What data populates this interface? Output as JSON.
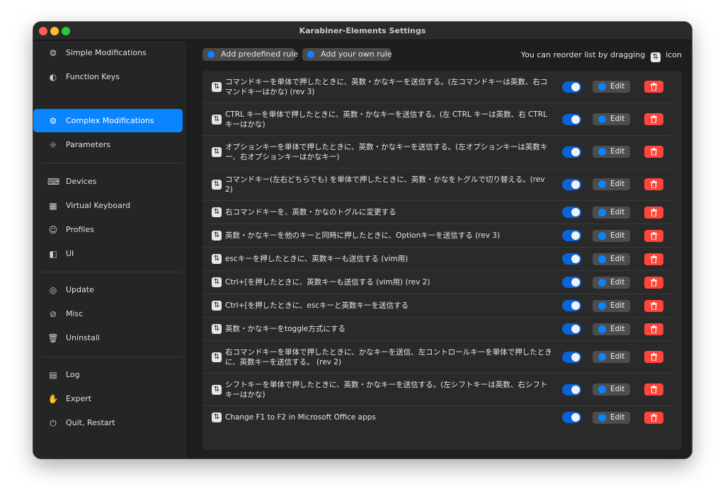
{
  "window": {
    "title": "Karabiner-Elements Settings"
  },
  "sidebar": {
    "items": [
      {
        "label": "Simple Modifications",
        "icon": "gear-icon",
        "active": false
      },
      {
        "label": "Function Keys",
        "icon": "function-key-icon",
        "active": false
      },
      {
        "label": "Complex Modifications",
        "icon": "gears-icon",
        "active": true
      },
      {
        "label": "Parameters",
        "icon": "sun-icon",
        "active": false
      },
      {
        "label": "Devices",
        "icon": "keyboard-icon",
        "active": false
      },
      {
        "label": "Virtual Keyboard",
        "icon": "puzzle-icon",
        "active": false
      },
      {
        "label": "Profiles",
        "icon": "profiles-icon",
        "active": false
      },
      {
        "label": "UI",
        "icon": "toggles-icon",
        "active": false
      },
      {
        "label": "Update",
        "icon": "globe-icon",
        "active": false
      },
      {
        "label": "Misc",
        "icon": "misc-icon",
        "active": false
      },
      {
        "label": "Uninstall",
        "icon": "trash-icon",
        "active": false
      },
      {
        "label": "Log",
        "icon": "document-icon",
        "active": false
      },
      {
        "label": "Expert",
        "icon": "hand-icon",
        "active": false
      },
      {
        "label": "Quit, Restart",
        "icon": "power-icon",
        "active": false
      }
    ]
  },
  "toolbar": {
    "add_predefined": "Add predefined rule",
    "add_own": "Add your own rule",
    "hint_before": "You can reorder list by dragging",
    "hint_after": "icon"
  },
  "rules": [
    {
      "text": "コマンドキーを単体で押したときに、英数・かなキーを送信する。(左コマンドキーは英数、右コマンドキーはかな) (rev 3)",
      "enabled": true,
      "edit": "Edit"
    },
    {
      "text": "CTRL キーを単体で押したときに、英数・かなキーを送信する。(左 CTRL キーは英数、右 CTRL キーはかな)",
      "enabled": true,
      "edit": "Edit"
    },
    {
      "text": "オプションキーを単体で押したときに、英数・かなキーを送信する。(左オプションキーは英数キー、右オプションキーはかなキー)",
      "enabled": true,
      "edit": "Edit"
    },
    {
      "text": "コマンドキー(左右どちらでも) を単体で押したときに、英数・かなをトグルで切り替える。(rev 2)",
      "enabled": true,
      "edit": "Edit"
    },
    {
      "text": "右コマンドキーを、英数・かなのトグルに変更する",
      "enabled": true,
      "edit": "Edit"
    },
    {
      "text": "英数・かなキーを他のキーと同時に押したときに、Optionキーを送信する (rev 3)",
      "enabled": true,
      "edit": "Edit"
    },
    {
      "text": "escキーを押したときに、英数キーも送信する (vim用)",
      "enabled": true,
      "edit": "Edit"
    },
    {
      "text": "Ctrl+[を押したときに、英数キーも送信する (vim用) (rev 2)",
      "enabled": true,
      "edit": "Edit"
    },
    {
      "text": "Ctrl+[を押したときに、escキーと英数キーを送信する",
      "enabled": true,
      "edit": "Edit"
    },
    {
      "text": "英数・かなキーをtoggle方式にする",
      "enabled": true,
      "edit": "Edit"
    },
    {
      "text": "右コマンドキーを単体で押したときに、かなキーを送信、左コントロールキーを単体で押したときに、英数キーを送信する。 (rev 2)",
      "enabled": true,
      "edit": "Edit"
    },
    {
      "text": "シフトキーを単体で押したときに、英数・かなキーを送信する。(左シフトキーは英数、右シフトキーはかな)",
      "enabled": true,
      "edit": "Edit"
    },
    {
      "text": "Change F1 to F2 in Microsoft Office apps",
      "enabled": true,
      "edit": "Edit"
    }
  ],
  "colors": {
    "accent": "#0a84ff",
    "delete": "#ff453a",
    "background": "#1e1e1e",
    "sidebar": "#252525"
  }
}
